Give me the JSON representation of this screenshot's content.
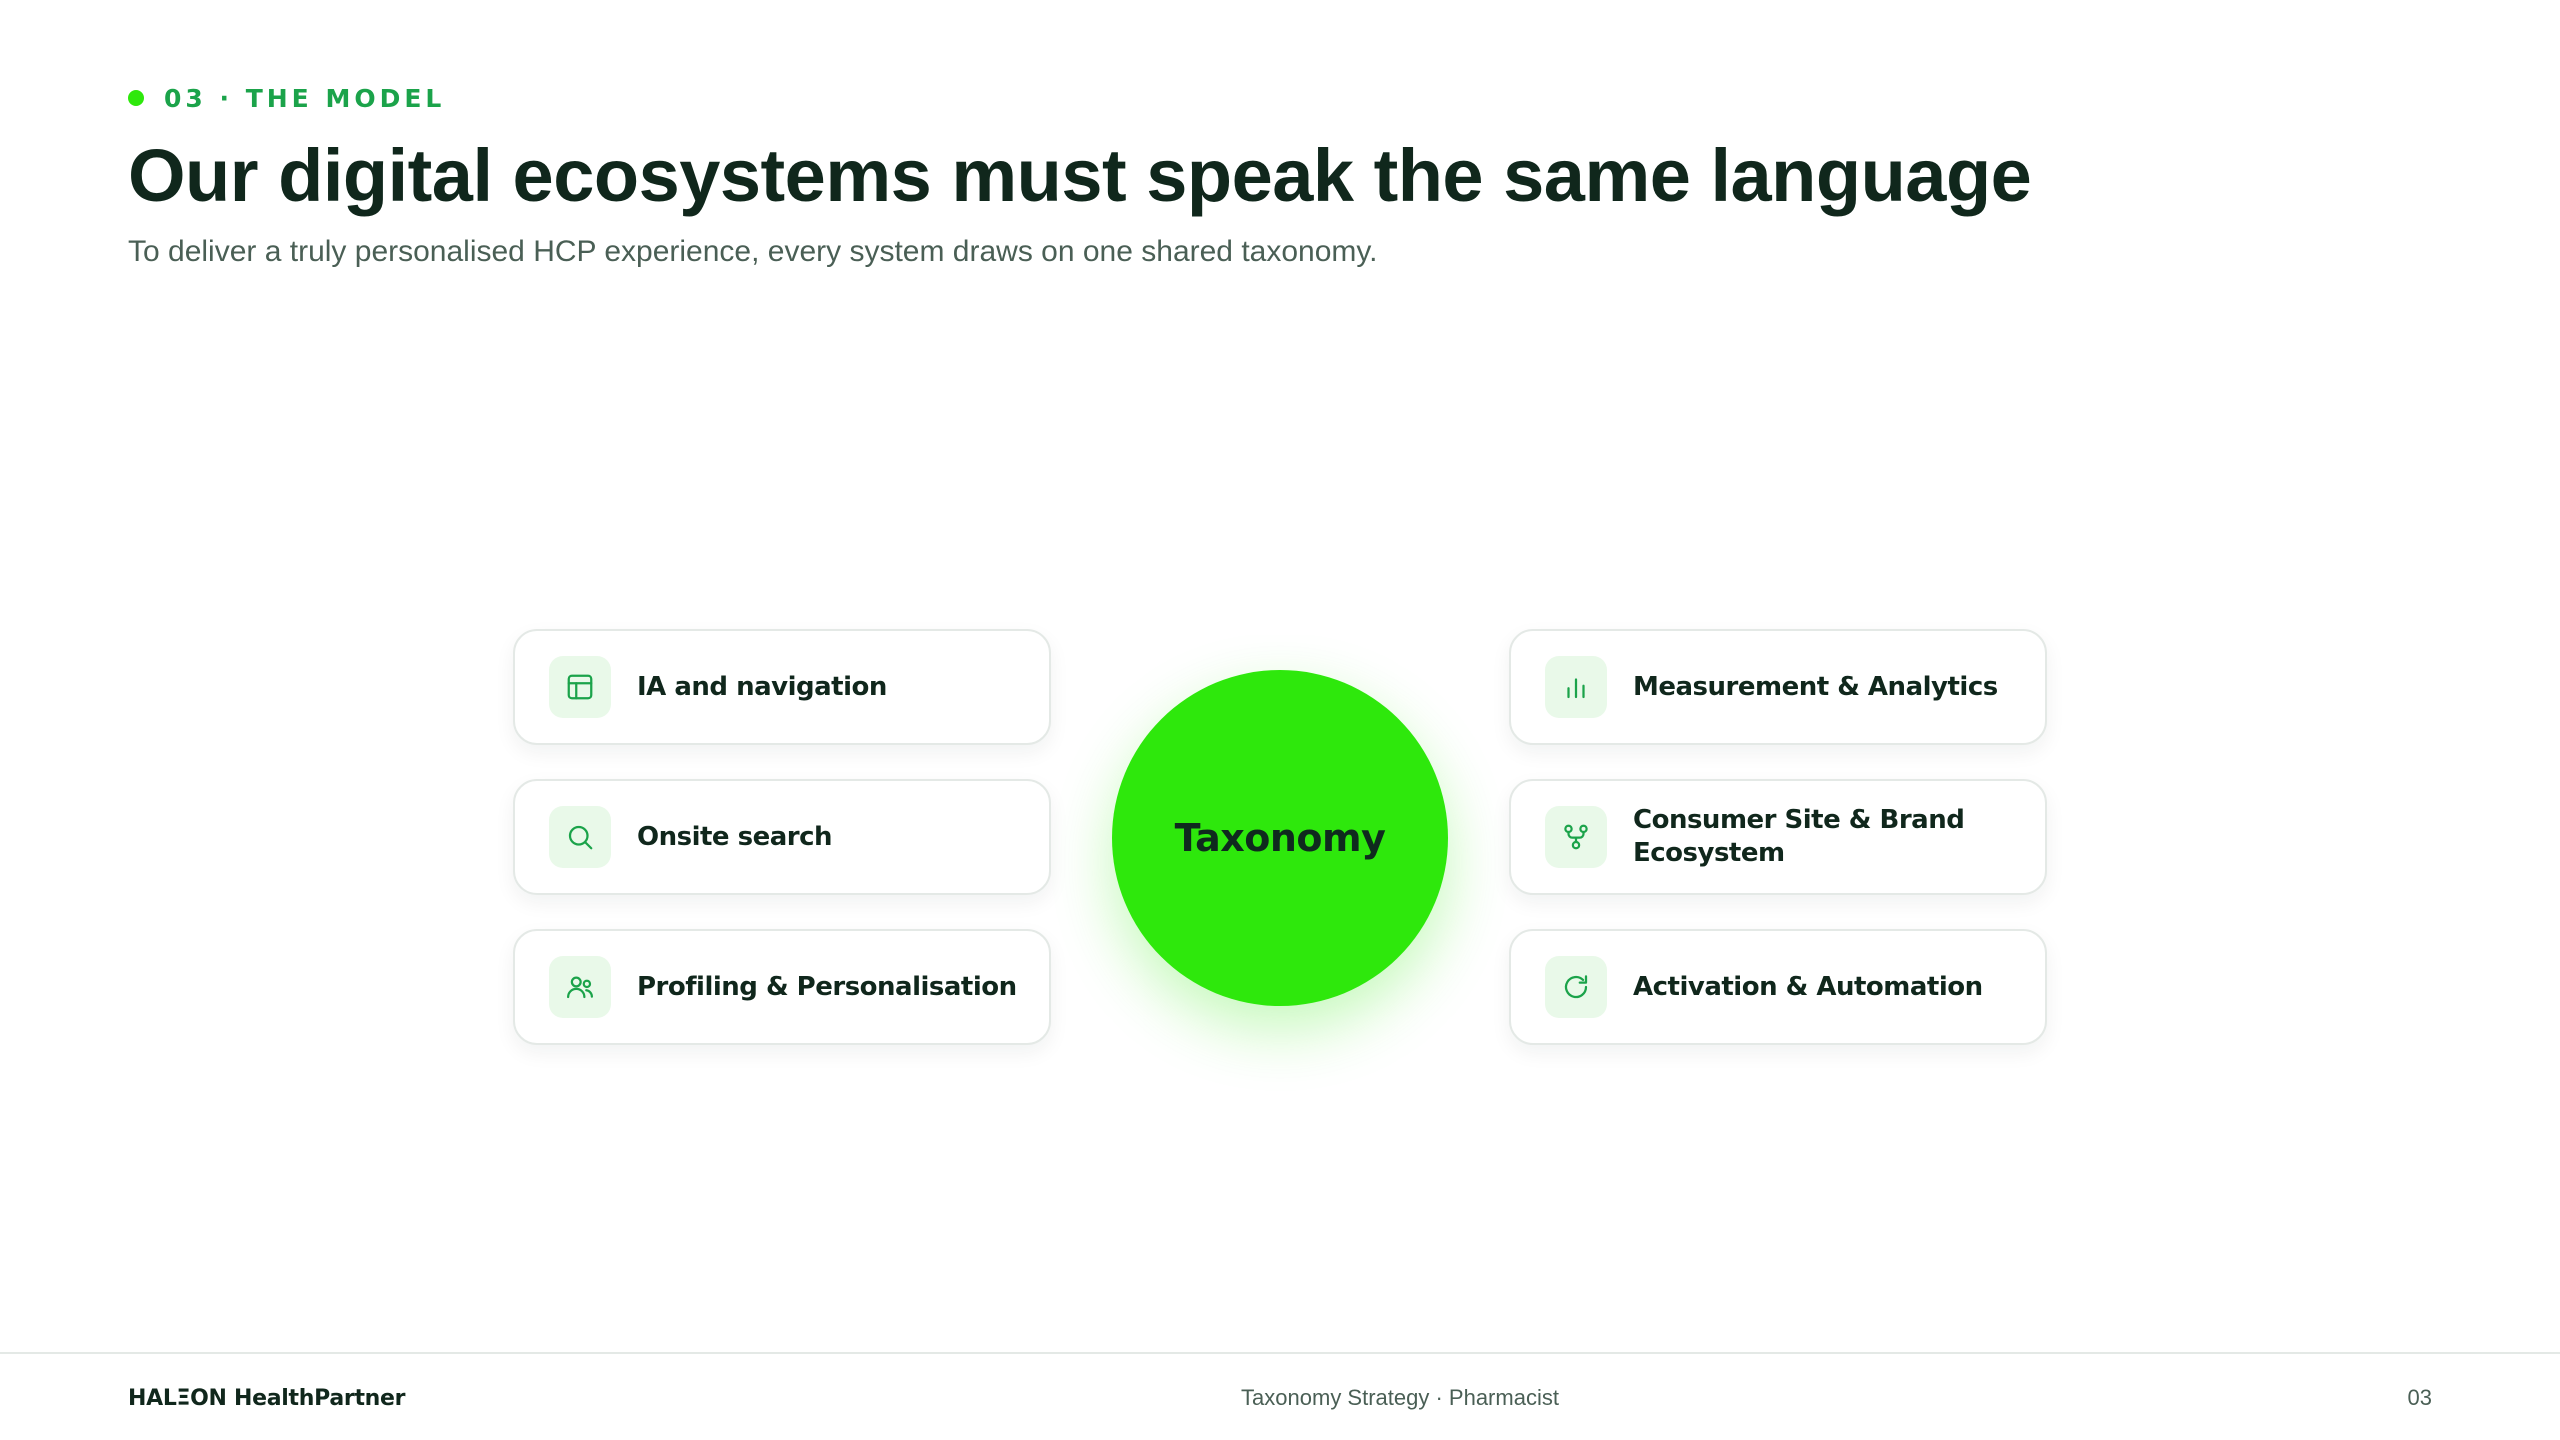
{
  "header": {
    "eyebrow": "03 · THE MODEL",
    "title": "Our digital ecosystems must speak the same language",
    "subtitle": "To deliver a truly personalised HCP experience, every system draws on one shared taxonomy."
  },
  "hub": {
    "label": "Taxonomy"
  },
  "left_cards": [
    {
      "label": "IA and navigation",
      "icon": "layout-icon"
    },
    {
      "label": "Onsite search",
      "icon": "search-icon"
    },
    {
      "label": "Profiling & Personalisation",
      "icon": "users-icon"
    }
  ],
  "right_cards": [
    {
      "label": "Measurement & Analytics",
      "icon": "bar-chart-icon"
    },
    {
      "label": "Consumer Site & Brand Ecosystem",
      "icon": "network-icon"
    },
    {
      "label": "Activation & Automation",
      "icon": "refresh-icon"
    }
  ],
  "footer": {
    "brand": "HALΞON HealthPartner",
    "center": "Taxonomy Strategy · Pharmacist",
    "page": "03"
  },
  "colors": {
    "accent": "#2ee80c",
    "accent_text": "#1ba34a",
    "icon_bg": "#e9f9e9",
    "heading": "#10271c",
    "muted": "#4a5f55"
  }
}
